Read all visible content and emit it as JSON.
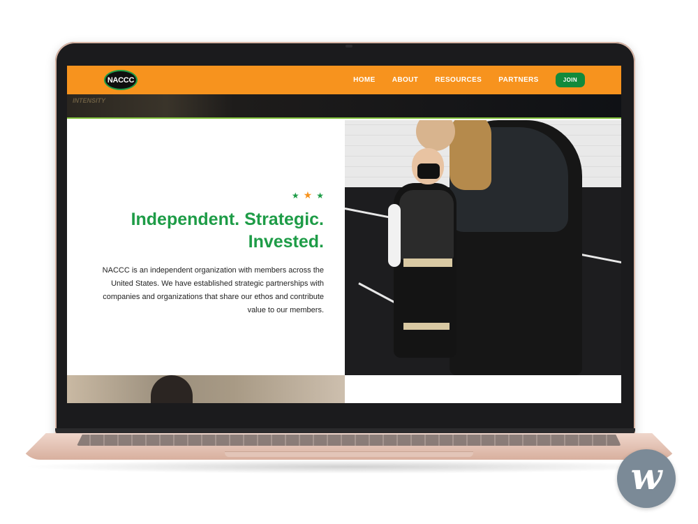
{
  "header": {
    "logo_text": "NACCC",
    "nav": [
      {
        "label": "HOME"
      },
      {
        "label": "ABOUT"
      },
      {
        "label": "RESOURCES"
      },
      {
        "label": "PARTNERS"
      }
    ],
    "join_label": "JOIN"
  },
  "hero_strip": {
    "gym_text": "INTENSITY"
  },
  "main": {
    "headline_line1": "Independent. Strategic.",
    "headline_line2": "Invested.",
    "body": "NACCC is an independent organization with members across the United States. We have established strategic partnerships with companies and organizations that share our ethos and contribute value to our members."
  },
  "watermark": {
    "letter": "w"
  },
  "colors": {
    "brand_orange": "#f7931e",
    "brand_green": "#1e9c47",
    "join_green": "#128a3c",
    "laptop_rose": "#e3c5b8"
  },
  "icons": {
    "stars": [
      "star-green-icon",
      "star-orange-icon",
      "star-green-icon"
    ]
  }
}
